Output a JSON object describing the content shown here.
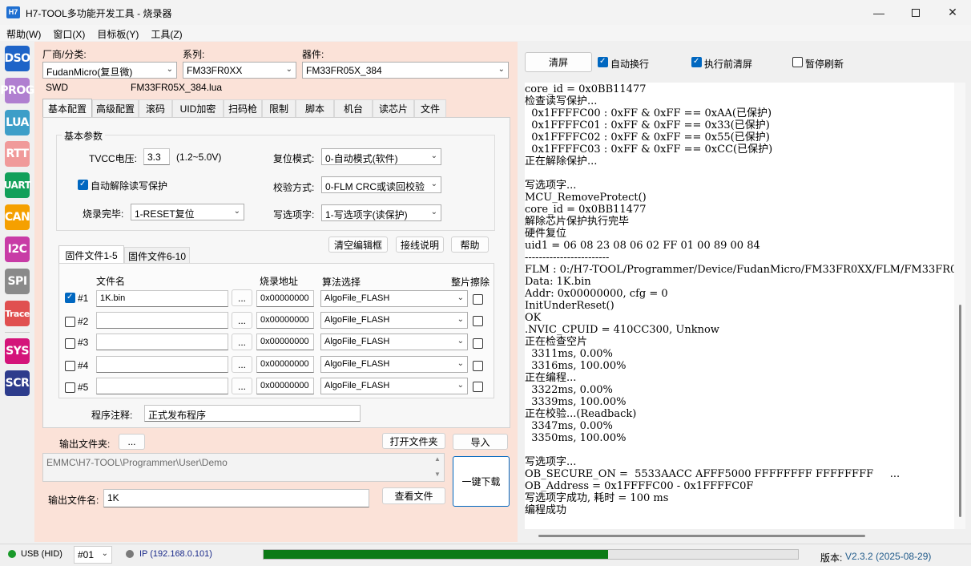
{
  "window": {
    "app_icon_text": "H7",
    "title": "H7-TOOL多功能开发工具 - 烧录器"
  },
  "menu": [
    "帮助(W)",
    "窗口(X)",
    "目标板(Y)",
    "工具(Z)"
  ],
  "sidebar": [
    {
      "label": "DSO",
      "color": "#1e64c8"
    },
    {
      "label": "PROG",
      "color": "#b07fd0"
    },
    {
      "label": "LUA",
      "color": "#3d9ec8"
    },
    {
      "label": "RTT",
      "color": "#f09a9a"
    },
    {
      "label": "UART",
      "color": "#12a05a"
    },
    {
      "label": "CAN",
      "color": "#f5a000"
    },
    {
      "label": "I2C",
      "color": "#c83ca6"
    },
    {
      "label": "SPI",
      "color": "#8a8a8a"
    },
    {
      "label": "Trace",
      "color": "#e05050"
    },
    {
      "label": "SYS",
      "color": "#d4147a"
    },
    {
      "label": "SCR",
      "color": "#2d3c8c"
    }
  ],
  "device": {
    "vendor_label": "厂商/分类:",
    "vendor_value": "FudanMicro(复旦微)",
    "series_label": "系列:",
    "series_value": "FM33FR0XX",
    "part_label": "器件:",
    "part_value": "FM33FR05X_384",
    "interface": "SWD",
    "lua_file": "FM33FR05X_384.lua"
  },
  "tabs": [
    "基本配置",
    "高级配置",
    "滚码",
    "UID加密",
    "扫码枪",
    "限制",
    "脚本",
    "机台",
    "读芯片",
    "文件"
  ],
  "basic": {
    "group_title": "基本参数",
    "tvcc_label": "TVCC电压:",
    "tvcc_value": "3.3",
    "tvcc_range": "(1.2~5.0V)",
    "reset_label": "复位模式:",
    "reset_value": "0-自动模式(软件)",
    "auto_unprotect_label": "自动解除读写保护",
    "auto_unprotect_checked": true,
    "verify_label": "校验方式:",
    "verify_value": "0-FLM CRC或读回校验",
    "after_label": "烧录完毕:",
    "after_value": "1-RESET复位",
    "option_label": "写选项字:",
    "option_value": "1-写选项字(读保护)"
  },
  "firmware": {
    "tab1": "固件文件1-5",
    "tab2": "固件文件6-10",
    "clear_btn": "清空编辑框",
    "wiring_btn": "接线说明",
    "help_btn": "帮助",
    "col_file": "文件名",
    "col_addr": "烧录地址",
    "col_algo": "算法选择",
    "col_erase": "整片擦除",
    "browse": "...",
    "rows": [
      {
        "id": "#1",
        "checked": true,
        "file": "1K.bin",
        "addr": "0x00000000",
        "algo": "AlgoFile_FLASH"
      },
      {
        "id": "#2",
        "checked": false,
        "file": "",
        "addr": "0x00000000",
        "algo": "AlgoFile_FLASH"
      },
      {
        "id": "#3",
        "checked": false,
        "file": "",
        "addr": "0x00000000",
        "algo": "AlgoFile_FLASH"
      },
      {
        "id": "#4",
        "checked": false,
        "file": "",
        "addr": "0x00000000",
        "algo": "AlgoFile_FLASH"
      },
      {
        "id": "#5",
        "checked": false,
        "file": "",
        "addr": "0x00000000",
        "algo": "AlgoFile_FLASH"
      }
    ],
    "note_label": "程序注释:",
    "note_value": "正式发布程序"
  },
  "output": {
    "folder_label": "输出文件夹:",
    "folder_btn": "...",
    "open_folder_btn": "打开文件夹",
    "import_btn": "导入",
    "path": "EMMC\\H7-TOOL\\Programmer\\User\\Demo",
    "name_label": "输出文件名:",
    "name_value": "1K",
    "view_btn": "查看文件",
    "download_btn": "一键下载"
  },
  "console_bar": {
    "clear_btn": "清屏",
    "auto_wrap_label": "自动换行",
    "auto_wrap_checked": true,
    "clear_before_label": "执行前清屏",
    "clear_before_checked": true,
    "pause_label": "暂停刷新",
    "pause_checked": false
  },
  "console_lines": [
    "core_id = 0x0BB11477",
    "检查读写保护...",
    "  0x1FFFFC00 : 0xFF & 0xFF == 0xAA(已保护)",
    "  0x1FFFFC01 : 0xFF & 0xFF == 0x33(已保护)",
    "  0x1FFFFC02 : 0xFF & 0xFF == 0x55(已保护)",
    "  0x1FFFFC03 : 0xFF & 0xFF == 0xCC(已保护)",
    "正在解除保护...",
    "",
    "写选项字...",
    "MCU_RemoveProtect()",
    "core_id = 0x0BB11477",
    "解除芯片保护执行完毕",
    "硬件复位",
    "uid1 = 06 08 23 08 06 02 FF 01 00 89 00 84",
    "------------------------",
    "FLM : 0:/H7-TOOL/Programmer/Device/FudanMicro/FM33FR0XX/FLM/FM33FR0",
    "Data: 1K.bin",
    "Addr: 0x00000000, cfg = 0",
    "InitUnderReset()",
    "OK",
    ".NVIC_CPUID = 410CC300, Unknow",
    "正在检查空片",
    "  3311ms, 0.00%",
    "  3316ms, 100.00%",
    "正在编程...",
    "  3322ms, 0.00%",
    "  3339ms, 100.00%",
    "正在校验...(Readback)",
    "  3347ms, 0.00%",
    "  3350ms, 100.00%",
    "",
    "写选项字...",
    "OB_SECURE_ON =  5533AACC AFFF5000 FFFFFFFF FFFFFFFF     ...",
    "OB_Address = 0x1FFFFC00 - 0x1FFFFC0F",
    "写选项字成功, 耗时 = 100 ms",
    "编程成功"
  ],
  "status": {
    "usb_label": "USB (HID)",
    "usb_color": "#1a9a2a",
    "port_value": "#01",
    "ip_label": "IP (192.168.0.101)",
    "ip_color": "#7a7a7a",
    "progress_fraction": 0.645,
    "progress_color": "#0c7a16",
    "version_label": "版本:",
    "version_value": "V2.3.2 (2025-08-29)"
  }
}
